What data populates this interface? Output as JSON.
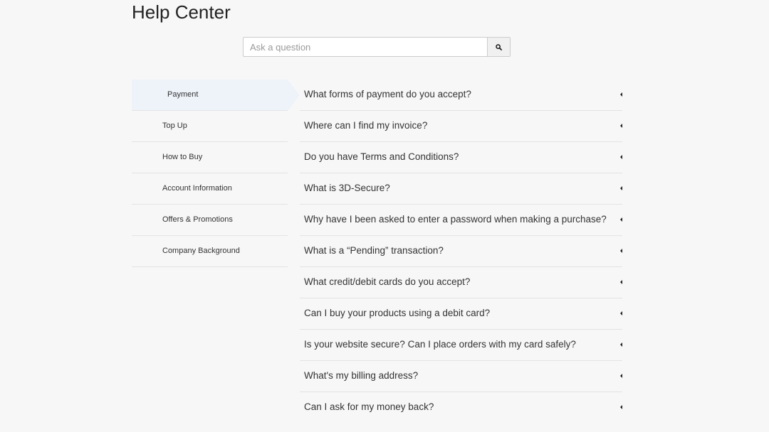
{
  "header": {
    "title": "Help Center"
  },
  "search": {
    "placeholder": "Ask a question",
    "button_icon": "search-icon"
  },
  "sidebar": {
    "active_index": 0,
    "items": [
      {
        "label": "Payment"
      },
      {
        "label": "Top Up"
      },
      {
        "label": "How to Buy"
      },
      {
        "label": "Account Information"
      },
      {
        "label": "Offers & Promotions"
      },
      {
        "label": "Company Background"
      }
    ]
  },
  "faq": {
    "toggle_icon": "caret-left-icon",
    "items": [
      {
        "question": "What forms of payment do you accept?"
      },
      {
        "question": "Where can I find my invoice?"
      },
      {
        "question": "Do you have Terms and Conditions?"
      },
      {
        "question": "What is 3D-Secure?"
      },
      {
        "question": "Why have I been asked to enter a password when making a purchase?"
      },
      {
        "question": "What is a “Pending” transaction?"
      },
      {
        "question": "What credit/debit cards do you accept?"
      },
      {
        "question": "Can I buy your products using a debit card?"
      },
      {
        "question": "Is your website secure? Can I place orders with my card safely?"
      },
      {
        "question": "What's my billing address?"
      },
      {
        "question": "Can I ask for my money back?"
      }
    ]
  }
}
